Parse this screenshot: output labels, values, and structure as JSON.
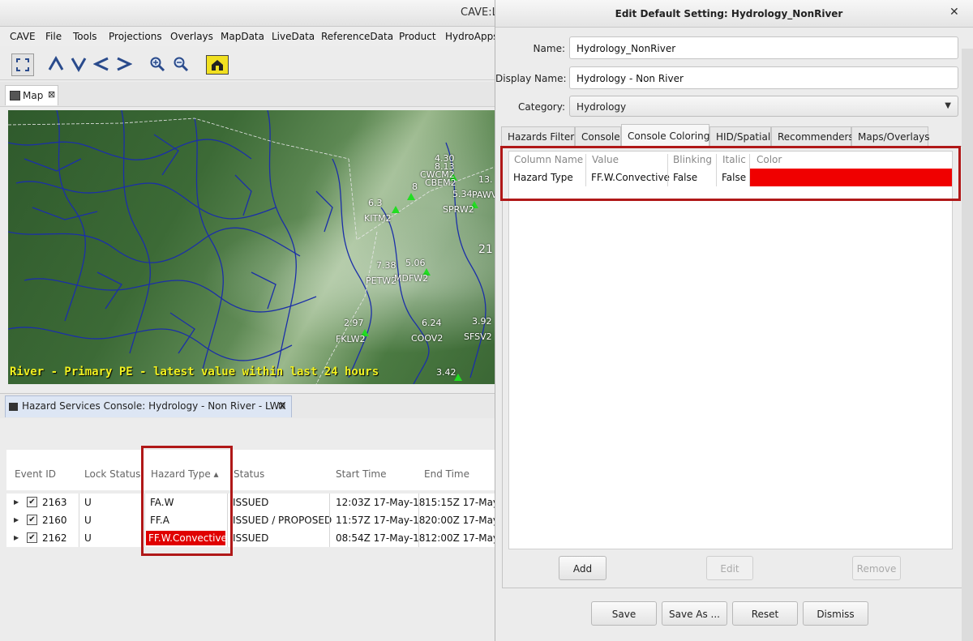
{
  "cave": {
    "title": "CAVE:L",
    "menu": [
      "CAVE",
      "File",
      "Tools",
      "Projections",
      "Overlays",
      "MapData",
      "LiveData",
      "ReferenceData",
      "Product",
      "HydroApps"
    ],
    "map_tab": {
      "label": "Map",
      "close": "⊠"
    },
    "map": {
      "caption": "River - Primary PE - latest value within last 24 hours",
      "readouts": [
        "4.30",
        "8.13",
        "CWCM2",
        "13.",
        "CBEM2",
        "5.34",
        "PAWV",
        "6.3",
        "8",
        "SPRW2",
        "KITM2",
        "21",
        "7.38",
        "5.06",
        "PETW2",
        "MDFW2",
        "2.97",
        "6.24",
        "3.92",
        "FKLW2",
        "COOV2",
        "SFSV2",
        "3.42"
      ],
      "colors": {
        "rivers": "#1b2fa8",
        "caption": "#f0f020",
        "station": "#22dd22"
      }
    },
    "console": {
      "tab_label": "Hazard Services Console: Hydrology - Non River - LWX",
      "tab_close": "⊠",
      "columns": [
        "Event ID",
        "Lock Status",
        "Hazard Type ▴",
        "Status",
        "Start Time",
        "End Time"
      ],
      "rows": [
        {
          "id": "2163",
          "lock": "U",
          "type": "FA.W",
          "status": "ISSUED",
          "start": "12:03Z 17-May-18",
          "end": "15:15Z 17-May-"
        },
        {
          "id": "2160",
          "lock": "U",
          "type": "FF.A",
          "status": "ISSUED / PROPOSED",
          "start": "11:57Z 17-May-18",
          "end": "20:00Z 17-May-"
        },
        {
          "id": "2162",
          "lock": "U",
          "type": "FF.W.Convective",
          "status": "ISSUED",
          "start": "08:54Z 17-May-18",
          "end": "12:00Z 17-May-"
        }
      ],
      "highlight_color": "#e00000"
    }
  },
  "dialog": {
    "title": "Edit Default Setting: Hydrology_NonRiver",
    "close": "✕",
    "name_label": "Name:",
    "name_value": "Hydrology_NonRiver",
    "display_name_label": "Display Name:",
    "display_name_value": "Hydrology - Non River",
    "category_label": "Category:",
    "category_value": "Hydrology",
    "tabs": [
      "Hazards Filter",
      "Console",
      "Console Coloring",
      "HID/Spatial",
      "Recommenders",
      "Maps/Overlays"
    ],
    "active_tab": "Console Coloring",
    "table": {
      "columns": [
        "Column Name",
        "Value",
        "Blinking",
        "Italic",
        "Color"
      ],
      "rows": [
        {
          "column_name": "Hazard Type",
          "value": "FF.W.Convective",
          "blinking": "False",
          "italic": "False",
          "color": "#f00000"
        }
      ]
    },
    "buttons": {
      "add": "Add",
      "edit": "Edit",
      "remove": "Remove",
      "save": "Save",
      "save_as": "Save As ...",
      "reset": "Reset",
      "dismiss": "Dismiss"
    }
  },
  "annotation_color": "#b01818"
}
